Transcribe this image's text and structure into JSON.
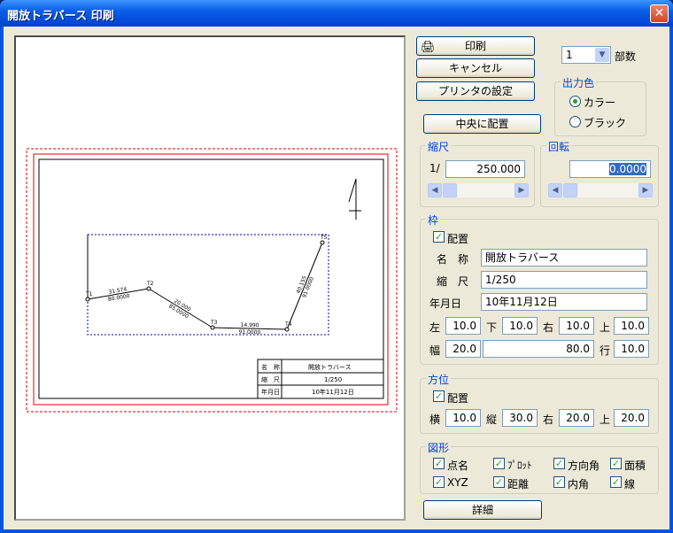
{
  "window": {
    "title": "開放トラバース 印刷",
    "close": "✕"
  },
  "buttons": {
    "print": "印刷",
    "cancel": "キャンセル",
    "printer_settings": "プリンタの設定",
    "center": "中央に配置",
    "detail": "詳細"
  },
  "copies": {
    "value": "1",
    "label": "部数"
  },
  "output_color": {
    "title": "出力色",
    "color": "カラー",
    "black": "ブラック",
    "selected": "color"
  },
  "scale": {
    "title": "縮尺",
    "prefix": "1/",
    "value": "250.000"
  },
  "rotation": {
    "title": "回転",
    "value": "0.0000"
  },
  "frame": {
    "title": "枠",
    "place": "配置",
    "name_label": "名　称",
    "name": "開放トラバース",
    "scale_label": "縮　尺",
    "scale": "1/250",
    "date_label": "年月日",
    "date": "10年11月12日",
    "left_label": "左",
    "left": "10.0",
    "bottom_label": "下",
    "bottom": "10.0",
    "right_label": "右",
    "right": "10.0",
    "top_label": "上",
    "top": "10.0",
    "width_label": "幅",
    "width": "20.0",
    "col_value": "80.0",
    "row_label": "行",
    "row": "10.0"
  },
  "orientation": {
    "title": "方位",
    "place": "配置",
    "h_label": "横",
    "h": "10.0",
    "v_label": "縦",
    "v": "30.0",
    "right_label": "右",
    "right": "20.0",
    "top_label": "上",
    "top": "20.0"
  },
  "shapes": {
    "title": "図形",
    "items": [
      "点名",
      "ﾌﾟﾛｯﾄ",
      "方向角",
      "面積",
      "XYZ",
      "距離",
      "内角",
      "線"
    ]
  },
  "preview": {
    "points": [
      "T1",
      "T2",
      "T3",
      "T4",
      "T5"
    ],
    "dists": [
      "31.574",
      "20.000",
      "14.990",
      "40.155"
    ],
    "angles": [
      "80.0000",
      "85.0000",
      "91.0000",
      "91.0000"
    ],
    "table": [
      [
        "名　称",
        "開放トラバース"
      ],
      [
        "縮　尺",
        "1/250"
      ],
      [
        "年月日",
        "10年11月12日"
      ]
    ]
  }
}
